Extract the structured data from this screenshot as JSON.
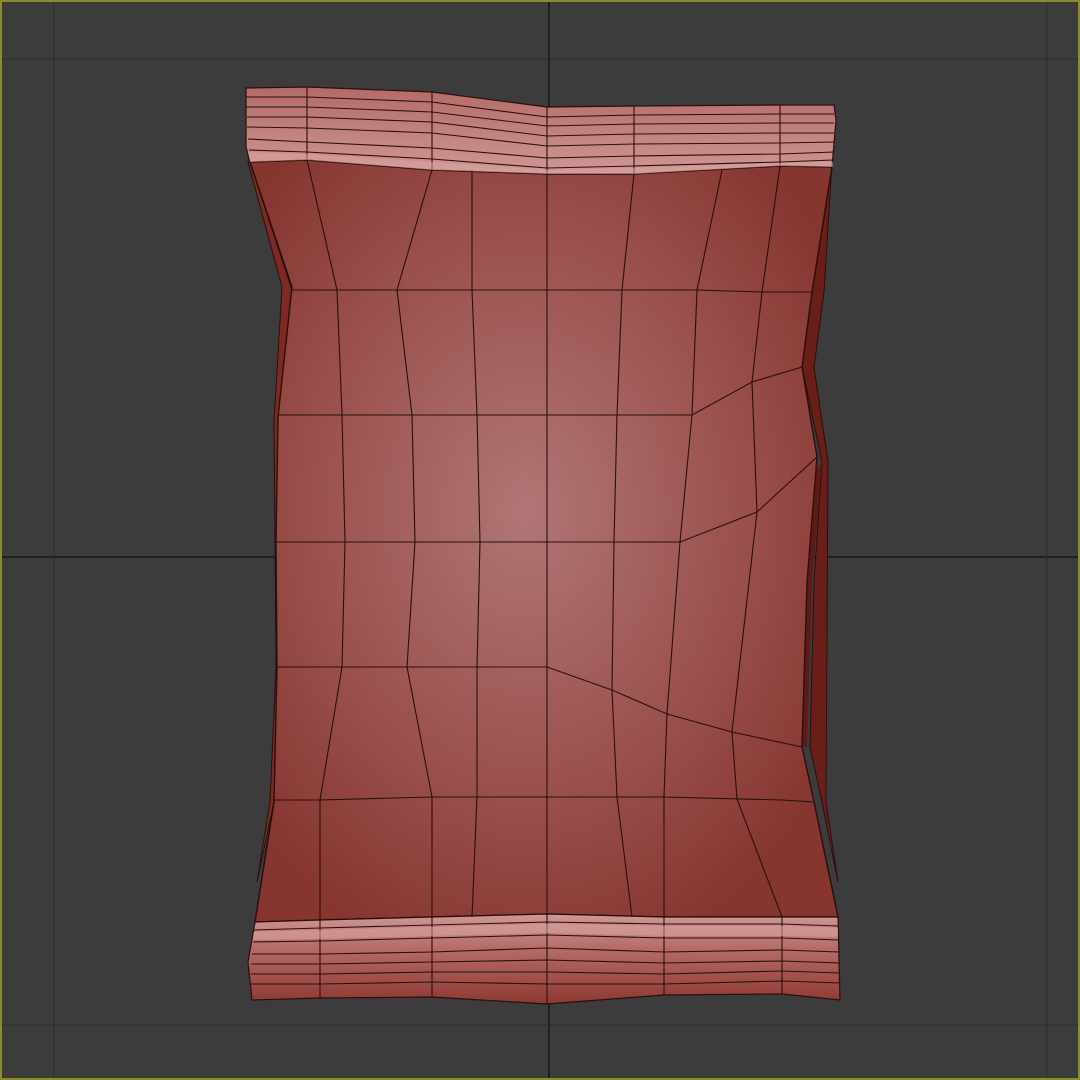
{
  "viewport": {
    "view": "front",
    "background_color": "#3c3c3c",
    "border_color": "#8c8a2a",
    "grid_line_color": "#1a1a1a",
    "grid_visible": true
  },
  "model": {
    "object": "chip-bag-mesh",
    "display": "smooth-shaded-with-wireframe",
    "base_color": "#a3504c",
    "highlight_color": "#b07675",
    "side_color": "#7e2a22",
    "dark_side_color": "#5e1a14",
    "crimp_light_color": "#c98a88",
    "wire_color": "#2a0f0d"
  }
}
